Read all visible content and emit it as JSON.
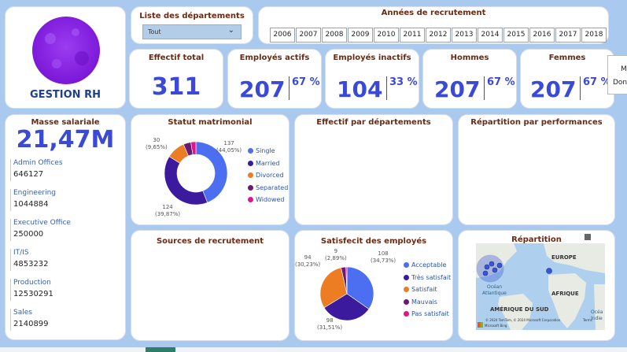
{
  "brand": {
    "title": "GESTION RH",
    "logo_color": "#8b2be2"
  },
  "departments_filter": {
    "title": "Liste des départements",
    "selected": "Tout"
  },
  "years": {
    "title": "Années de recrutement",
    "items": [
      "2006",
      "2007",
      "2008",
      "2009",
      "2010",
      "2011",
      "2012",
      "2013",
      "2014",
      "2015",
      "2016",
      "2017",
      "2018"
    ]
  },
  "kpis": {
    "total": {
      "title": "Effectif total",
      "value": "311"
    },
    "active": {
      "title": "Employés actifs",
      "value": "207",
      "pct": "67 %"
    },
    "inactive": {
      "title": "Employés inactifs",
      "value": "104",
      "pct": "33 %"
    },
    "men": {
      "title": "Hommes",
      "value": "207",
      "pct": "67 %"
    },
    "women": {
      "title": "Femmes",
      "value": "207",
      "pct": "67 %"
    }
  },
  "tooltip_fragment": {
    "line1": "M",
    "line2": "Don"
  },
  "payroll": {
    "title": "Masse salariale",
    "value": "21,47M",
    "items": [
      {
        "label": "Admin Offices",
        "value": "646127"
      },
      {
        "label": "Engineering",
        "value": "1044884"
      },
      {
        "label": "Executive Office",
        "value": "250000"
      },
      {
        "label": "IT/IS",
        "value": "4853232"
      },
      {
        "label": "Production",
        "value": "12530291"
      },
      {
        "label": "Sales",
        "value": "2140899"
      }
    ]
  },
  "panels": {
    "marital": "Statut matrimonial",
    "by_dept": "Effectif par départements",
    "performance": "Répartition par performances",
    "sources": "Sources de recrutement",
    "satisfaction": "Satisfecit des employés",
    "map": "Répartition"
  },
  "map": {
    "labels": {
      "europe": "EUROPE",
      "ocean": "Océan",
      "atlantique": "Atlantique",
      "afrique": "AFRIQUE",
      "amerique": "AMÉRIQUE DU SUD",
      "ocean2": "Océa",
      "indien": "Indie"
    },
    "copyright": "© 2024 TomTom, © 2024 Microsoft Corporation",
    "terms": "Terms",
    "bing": "Microsoft Bing",
    "land_color": "#e7ebe3",
    "water_color": "#aed0ee"
  },
  "chart_data": [
    {
      "type": "pie",
      "title": "Statut matrimonial",
      "donut": true,
      "slices": [
        {
          "name": "Single",
          "value": 137,
          "label": "137",
          "pct": "(44,05%)",
          "color": "#4c6ef0"
        },
        {
          "name": "Married",
          "value": 124,
          "label": "124",
          "pct": "(39,87%)",
          "color": "#3c1a9e"
        },
        {
          "name": "Divorced",
          "value": 30,
          "label": "30",
          "pct": "(9,65%)",
          "color": "#ec7d22"
        },
        {
          "name": "Separated",
          "value": 12,
          "label": "",
          "pct": "",
          "color": "#6b1a72"
        },
        {
          "name": "Widowed",
          "value": 8,
          "label": "",
          "pct": "",
          "color": "#e0148c"
        }
      ]
    },
    {
      "type": "pie",
      "title": "Satisfecit des employés",
      "donut": false,
      "slices": [
        {
          "name": "Acceptable",
          "value": 108,
          "label": "108",
          "pct": "(34,73%)",
          "color": "#4c6ef0"
        },
        {
          "name": "Très satisfait",
          "value": 98,
          "label": "98",
          "pct": "(31,51%)",
          "color": "#3c1a9e"
        },
        {
          "name": "Satisfait",
          "value": 94,
          "label": "94",
          "pct": "(30,23%)",
          "color": "#ec7d22"
        },
        {
          "name": "Mauvais",
          "value": 9,
          "label": "9",
          "pct": "(2,89%)",
          "color": "#6b1a72"
        },
        {
          "name": "Pas satisfait",
          "value": 2,
          "label": "",
          "pct": "",
          "color": "#e0148c"
        }
      ]
    }
  ]
}
